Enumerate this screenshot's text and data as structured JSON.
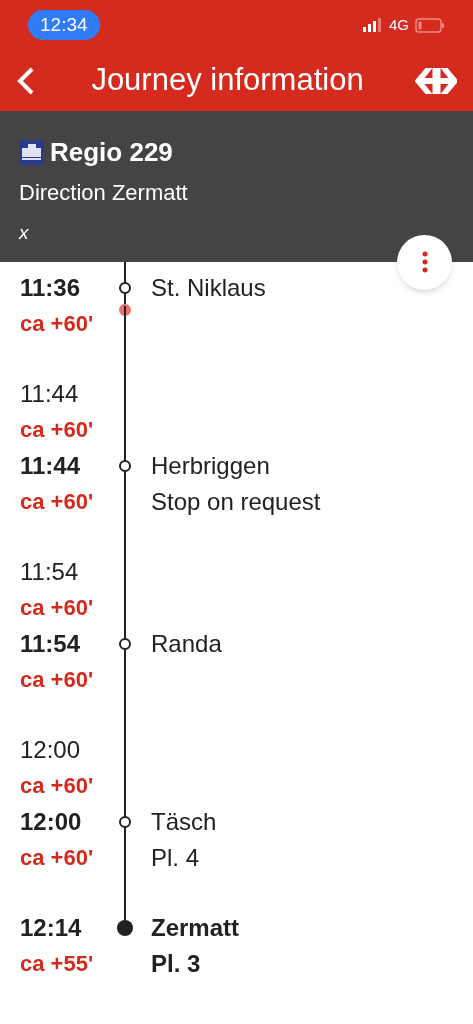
{
  "status_bar": {
    "time": "12:34",
    "network": "4G"
  },
  "header": {
    "title": "Journey information"
  },
  "train": {
    "name": "Regio 229",
    "direction": "Direction Zermatt",
    "note": "x"
  },
  "stops": [
    {
      "kind": "intermediate",
      "current": true,
      "departure": {
        "time": "11:36",
        "delay": "ca +60'"
      },
      "name": "St. Niklaus"
    },
    {
      "kind": "intermediate",
      "current": false,
      "arrival": {
        "time": "11:44",
        "delay": "ca +60'"
      },
      "departure": {
        "time": "11:44",
        "delay": "ca +60'"
      },
      "name": "Herbriggen",
      "note": "Stop on request"
    },
    {
      "kind": "intermediate",
      "current": false,
      "arrival": {
        "time": "11:54",
        "delay": "ca +60'"
      },
      "departure": {
        "time": "11:54",
        "delay": "ca +60'"
      },
      "name": "Randa"
    },
    {
      "kind": "intermediate",
      "current": false,
      "arrival": {
        "time": "12:00",
        "delay": "ca +60'"
      },
      "departure": {
        "time": "12:00",
        "delay": "ca +60'"
      },
      "name": "Täsch",
      "note": "Pl. 4"
    },
    {
      "kind": "terminus",
      "current": false,
      "departure": {
        "time": "12:14",
        "delay": "ca +55'"
      },
      "name": "Zermatt",
      "note": "Pl. 3"
    }
  ]
}
